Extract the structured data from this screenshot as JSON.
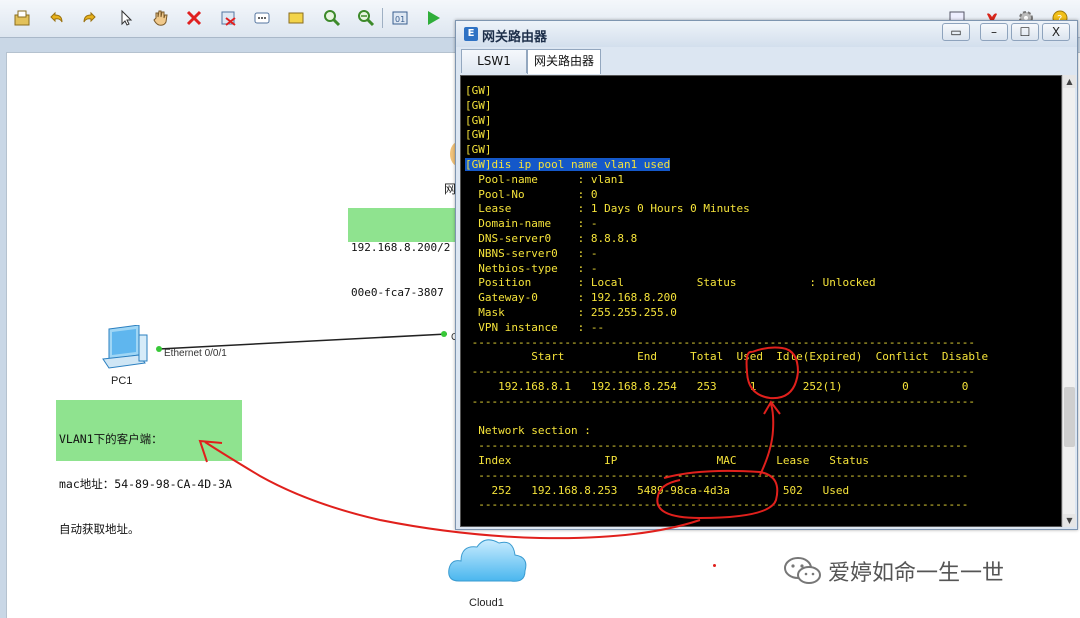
{
  "toolbar": {
    "left_icons": [
      "save-icon",
      "undo-icon",
      "redo-icon",
      "select-icon",
      "hand-icon",
      "delete-icon",
      "delete-link-icon",
      "text-icon",
      "rectangle-icon",
      "zoom-in-icon",
      "zoom-out-icon",
      "fit-icon",
      "start-icon",
      "stop-icon",
      "capture-icon",
      "topology-icon",
      "settings-icon",
      "cli-icon"
    ],
    "right_icons": [
      "console-icon",
      "huawei-icon",
      "gear-icon",
      "help-icon"
    ]
  },
  "canvas": {
    "pc1_label": "PC1",
    "cloud1_label": "Cloud1",
    "router_label_partial": "网",
    "pc1_port": "Ethernet 0/0/1",
    "router_port_partial": "G",
    "note_router": [
      "192.168.8.200/2",
      "00e0-fca7-3807"
    ],
    "note_client": [
      "VLAN1下的客户端：",
      "mac地址：54-89-98-CA-4D-3A",
      "自动获取地址。"
    ],
    "watermark": "爱婷如命一生一世"
  },
  "cli_window": {
    "title": "网关路由器",
    "controls": [
      "▭",
      "–",
      "☐",
      "X"
    ],
    "tabs": [
      "LSW1",
      "网关路由器"
    ],
    "active_tab": 1,
    "terminal_lines": [
      "[GW]",
      "[GW]",
      "[GW]",
      "[GW]",
      "[GW]",
      "[GW]dis ip pool name vlan1 used",
      "  Pool-name      : vlan1",
      "  Pool-No        : 0",
      "  Lease          : 1 Days 0 Hours 0 Minutes",
      "  Domain-name    : -",
      "  DNS-server0    : 8.8.8.8",
      "  NBNS-server0   : -",
      "  Netbios-type   : -",
      "  Position       : Local           Status           : Unlocked",
      "  Gateway-0      : 192.168.8.200",
      "  Mask           : 255.255.255.0",
      "  VPN instance   : --",
      " ----------------------------------------------------------------------------",
      "          Start           End     Total  Used  Idle(Expired)  Conflict  Disable",
      " ----------------------------------------------------------------------------",
      "     192.168.8.1   192.168.8.254   253     1       252(1)         0        0",
      " ----------------------------------------------------------------------------",
      "",
      "  Network section :",
      "  --------------------------------------------------------------------------",
      "  Index              IP               MAC      Lease   Status",
      "  --------------------------------------------------------------------------",
      "    252   192.168.8.253   5489-98ca-4d3a        502   Used",
      "  --------------------------------------------------------------------------"
    ],
    "command_line_index": 5
  },
  "colors": {
    "terminal_text": "#f5e33a",
    "terminal_bg": "#000000",
    "note_bg": "#8fe38f",
    "annotation": "#e0201c",
    "highlight": "#1458c9"
  }
}
